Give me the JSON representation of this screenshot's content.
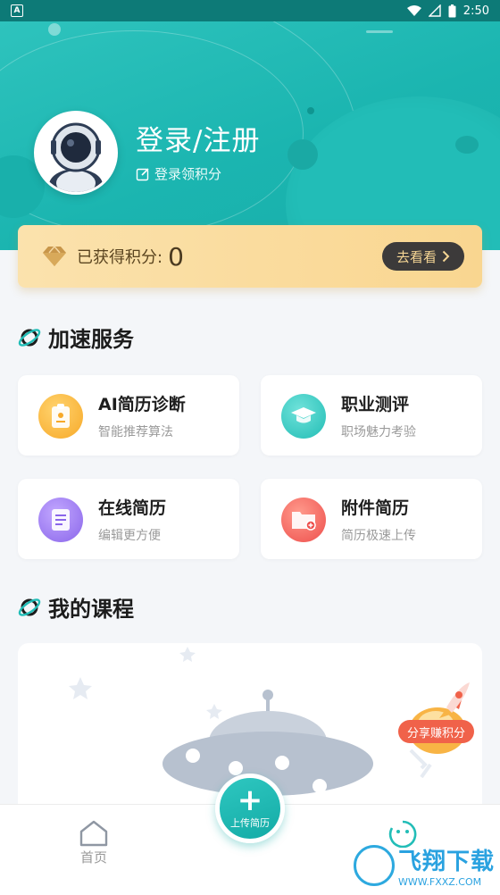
{
  "status_bar": {
    "time": "2:50",
    "left_badge": "A"
  },
  "profile": {
    "title": "登录/注册",
    "subtitle": "登录领积分"
  },
  "points": {
    "label": "已获得积分:",
    "value": "0",
    "button": "去看看"
  },
  "sections": {
    "services_title": "加速服务",
    "courses_title": "我的课程"
  },
  "services": [
    {
      "title": "AI简历诊断",
      "subtitle": "智能推荐算法",
      "icon": "resume-diagnosis-icon",
      "color": "#f9b43a"
    },
    {
      "title": "职业测评",
      "subtitle": "职场魅力考验",
      "icon": "graduation-cap-icon",
      "color": "#31c8c0"
    },
    {
      "title": "在线简历",
      "subtitle": "编辑更方便",
      "icon": "document-icon",
      "color": "#9d7bf0"
    },
    {
      "title": "附件简历",
      "subtitle": "简历极速上传",
      "icon": "folder-upload-icon",
      "color": "#f35f5a"
    }
  ],
  "course": {
    "share_label": "分享赚积分"
  },
  "nav": {
    "home": "首页",
    "fab": "上传简历"
  },
  "watermark": {
    "text": "飞翔下载",
    "url": "WWW.FXXZ.COM"
  },
  "colors": {
    "brand": "#1bb5b0",
    "points_bg": "#f9d690"
  }
}
